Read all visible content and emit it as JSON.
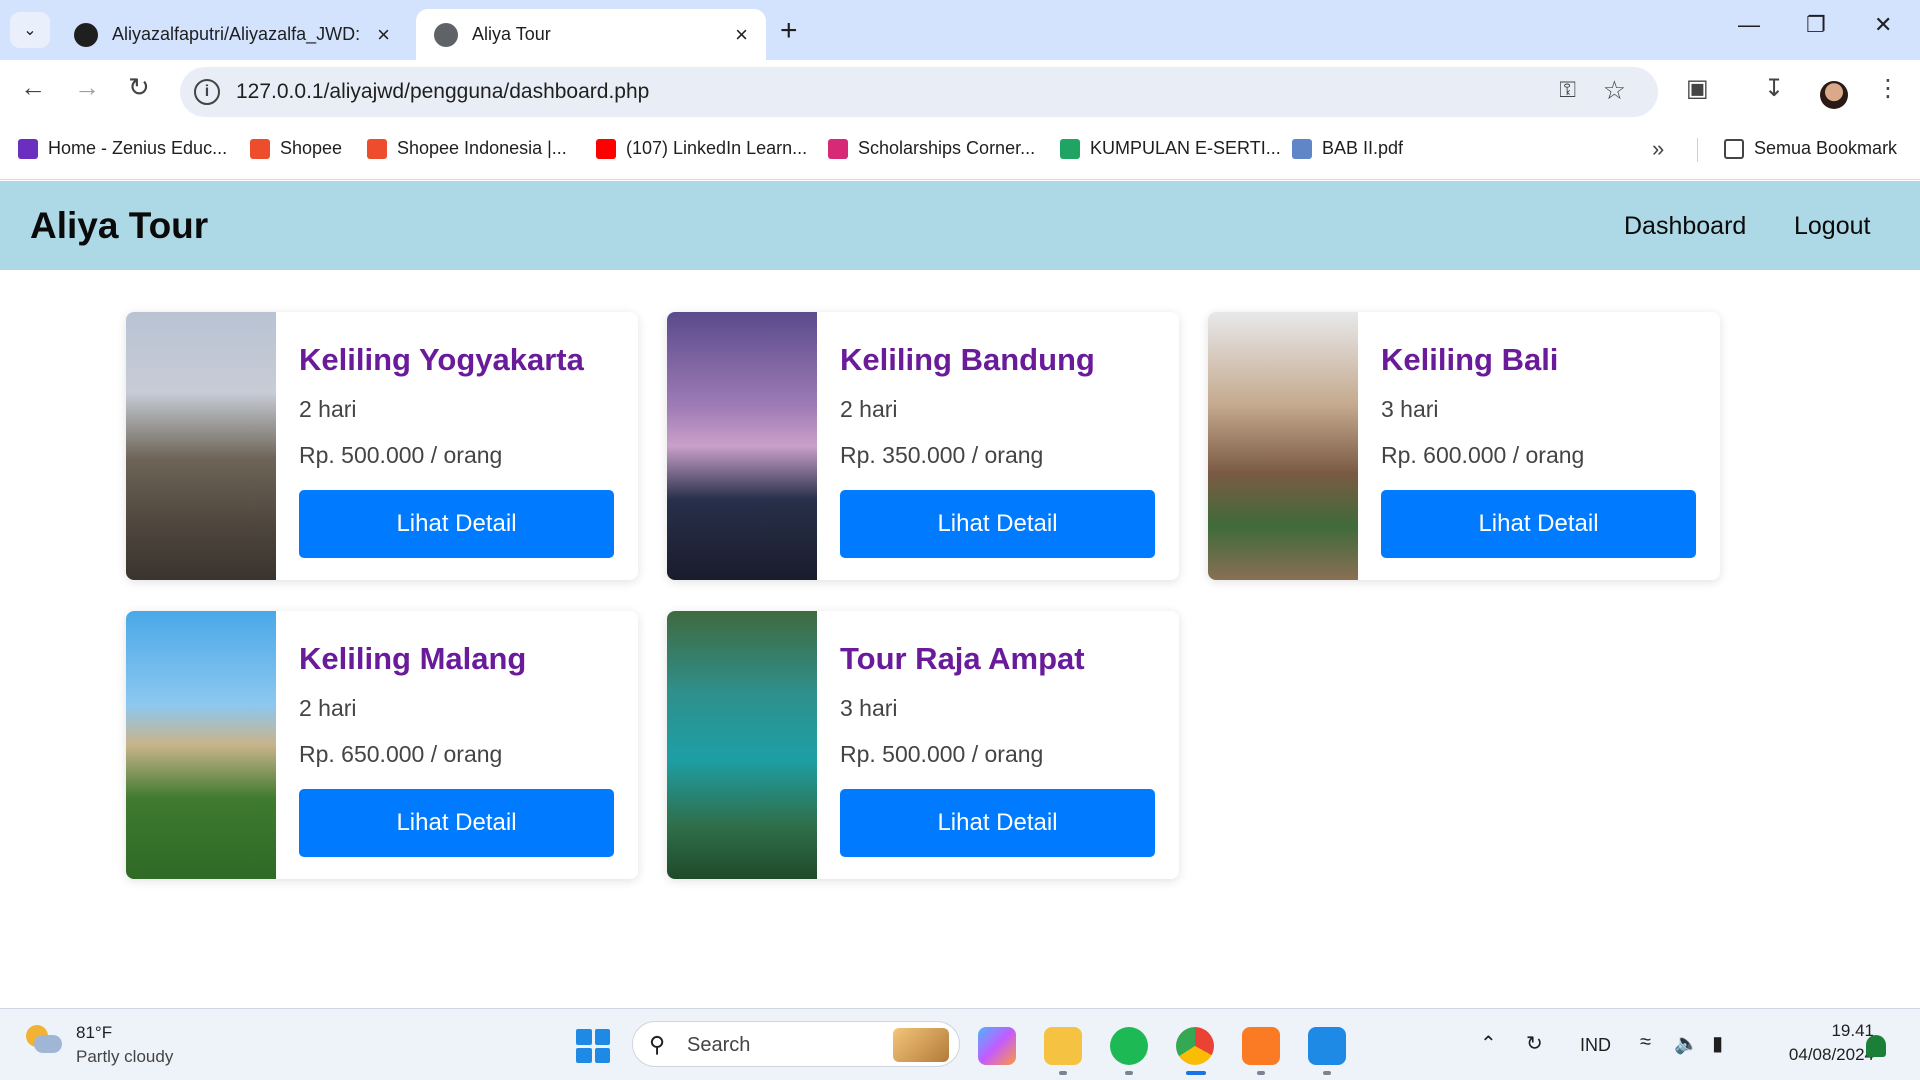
{
  "browser": {
    "tabs": [
      {
        "title": "Aliyazalfaputri/Aliyazalfa_JWD: ",
        "active": false
      },
      {
        "title": "Aliya Tour",
        "active": true
      }
    ],
    "url": "127.0.0.1/aliyajwd/pengguna/dashboard.php",
    "bookmarks": [
      {
        "label": "Home - Zenius Educ...",
        "icon": "zenius-icon",
        "color": "#6b2fbf"
      },
      {
        "label": "Shopee",
        "icon": "shopee-icon",
        "color": "#ee4d2d"
      },
      {
        "label": "Shopee Indonesia |...",
        "icon": "shopee-icon",
        "color": "#ee4d2d"
      },
      {
        "label": "(107) LinkedIn Learn...",
        "icon": "youtube-icon",
        "color": "#ff0000"
      },
      {
        "label": "Scholarships Corner...",
        "icon": "instagram-icon",
        "color": "#d62976"
      },
      {
        "label": "KUMPULAN E-SERTI...",
        "icon": "google-drive-icon",
        "color": "#1fa463"
      },
      {
        "label": "BAB II.pdf",
        "icon": "document-icon",
        "color": "#5f86c9"
      }
    ],
    "all_bookmarks_label": "Semua Bookmark"
  },
  "header": {
    "brand": "Aliya Tour",
    "nav": [
      "Dashboard",
      "Logout"
    ]
  },
  "tours": [
    {
      "name": "Keliling Yogyakarta",
      "duration": "2 hari",
      "price": "Rp. 500.000 / orang",
      "button": "Lihat Detail"
    },
    {
      "name": "Keliling Bandung",
      "duration": "2 hari",
      "price": "Rp. 350.000 / orang",
      "button": "Lihat Detail"
    },
    {
      "name": "Keliling Bali",
      "duration": "3 hari",
      "price": "Rp. 600.000 / orang",
      "button": "Lihat Detail"
    },
    {
      "name": "Keliling Malang",
      "duration": "2 hari",
      "price": "Rp. 650.000 / orang",
      "button": "Lihat Detail"
    },
    {
      "name": "Tour Raja Ampat",
      "duration": "3 hari",
      "price": "Rp. 500.000 / orang",
      "button": "Lihat Detail"
    }
  ],
  "colors": {
    "header_bg": "#add8e6",
    "tour_title": "#6a1b9a",
    "button": "#007bff"
  },
  "taskbar": {
    "weather_temp": "81°F",
    "weather_desc": "Partly cloudy",
    "search_placeholder": "Search",
    "language": "IND",
    "time": "19.41",
    "date": "04/08/2024"
  }
}
